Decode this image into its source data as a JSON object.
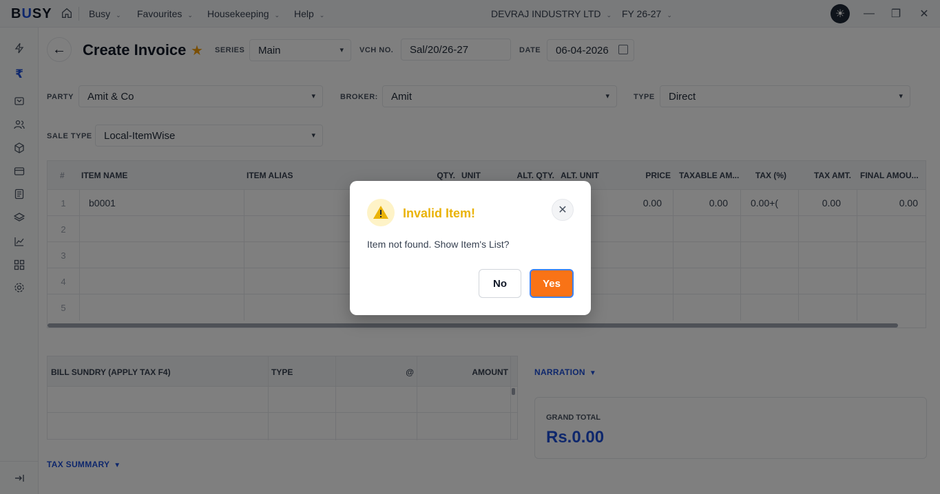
{
  "topbar": {
    "logo_pre": "B",
    "logo_u": "U",
    "logo_post": "SY",
    "menus": [
      "Busy",
      "Favourites",
      "Housekeeping",
      "Help"
    ],
    "company": "DEVRAJ INDUSTRY LTD",
    "fy": "FY 26-27"
  },
  "header": {
    "title": "Create Invoice",
    "series_label": "SERIES",
    "series_value": "Main",
    "vch_label": "VCH NO.",
    "vch_value": "Sal/20/26-27",
    "date_label": "DATE",
    "date_value": "06-04-2026"
  },
  "form": {
    "party_label": "PARTY",
    "party_value": "Amit & Co",
    "broker_label": "BROKER:",
    "broker_value": "Amit",
    "type_label": "TYPE",
    "type_value": "Direct",
    "sale_type_label": "SALE TYPE",
    "sale_type_value": "Local-ItemWise"
  },
  "grid": {
    "columns": [
      "#",
      "ITEM NAME",
      "ITEM ALIAS",
      "QTY.",
      "UNIT",
      "ALT. QTY.",
      "ALT. UNIT",
      "PRICE",
      "TAXABLE AM...",
      "TAX (%)",
      "TAX AMT.",
      "FINAL AMOU..."
    ],
    "rows": [
      {
        "num": "1",
        "item": "b0001",
        "price": "0.00",
        "taxable": "0.00",
        "tax_pct": "0.00+(",
        "tax_amt": "0.00",
        "final": "0.00"
      },
      {
        "num": "2"
      },
      {
        "num": "3"
      },
      {
        "num": "4"
      },
      {
        "num": "5"
      }
    ]
  },
  "bill_sundry": {
    "columns": [
      "BILL SUNDRY (APPLY TAX F4)",
      "TYPE",
      "@",
      "AMOUNT"
    ]
  },
  "narration_label": "NARRATION",
  "tax_summary_label": "TAX SUMMARY",
  "grand_total": {
    "label": "GRAND TOTAL",
    "value": "Rs.0.00"
  },
  "dialog": {
    "title": "Invalid Item!",
    "message": "Item not found. Show Item's List?",
    "no_label": "No",
    "yes_label": "Yes"
  }
}
